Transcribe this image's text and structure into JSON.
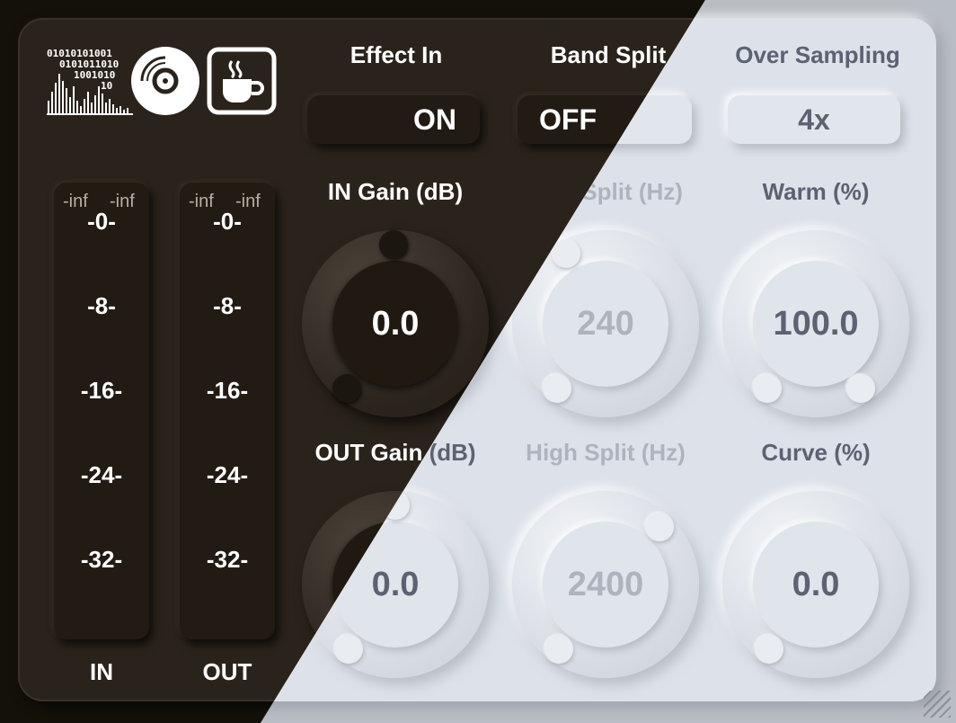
{
  "controls": {
    "effect_in": {
      "label": "Effect In",
      "value": "ON"
    },
    "band_split": {
      "label": "Band Split",
      "value": "OFF"
    },
    "over_sampling": {
      "label": "Over Sampling",
      "value": "4x"
    }
  },
  "knobs": {
    "in_gain": {
      "label": "IN Gain (dB)",
      "value": "0.0"
    },
    "low_split": {
      "label": "Low Split (Hz)",
      "value": "240"
    },
    "warm": {
      "label": "Warm (%)",
      "value": "100.0"
    },
    "out_gain": {
      "label": "OUT Gain (dB)",
      "value": "0.0"
    },
    "high_split": {
      "label": "High Split (Hz)",
      "value": "2400"
    },
    "curve": {
      "label": "Curve (%)",
      "value": "0.0"
    }
  },
  "meters": {
    "in": {
      "label": "IN",
      "left_peak": "-inf",
      "right_peak": "-inf"
    },
    "out": {
      "label": "OUT",
      "left_peak": "-inf",
      "right_peak": "-inf"
    },
    "ticks": [
      "-0-",
      "-8-",
      "-16-",
      "-24-",
      "-32-"
    ]
  },
  "logo": {
    "binary_rows": [
      "01010101001",
      "0101011010",
      "1001010",
      "10"
    ]
  },
  "icons": [
    "disc-icon",
    "coffee-icon"
  ]
}
